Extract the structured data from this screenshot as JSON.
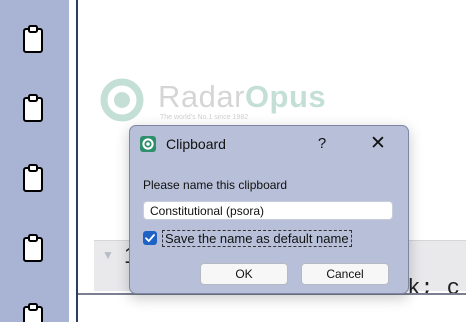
{
  "strip": {
    "icons": [
      "clipboard-icon",
      "clipboard-icon",
      "clipboard-icon",
      "clipboard-icon",
      "clipboard-icon"
    ]
  },
  "logo": {
    "name_part1": "Radar",
    "name_part2": "Opus",
    "tagline": "The world's No.1 since 1982"
  },
  "background": {
    "row_digit": "1",
    "text_fragment": "rk; c"
  },
  "dialog": {
    "title": "Clipboard",
    "help_label": "?",
    "close_label": "✕",
    "prompt": "Please name this clipboard",
    "name_value": "Constitutional (psora)",
    "checkbox_label": "Save the name as default name",
    "checkbox_checked": true,
    "ok_label": "OK",
    "cancel_label": "Cancel"
  },
  "colors": {
    "strip": "#a9b3d4",
    "dialog_bg": "#b7c0d8",
    "accent": "#1d62c4",
    "brand_green": "#2e8f6b"
  }
}
